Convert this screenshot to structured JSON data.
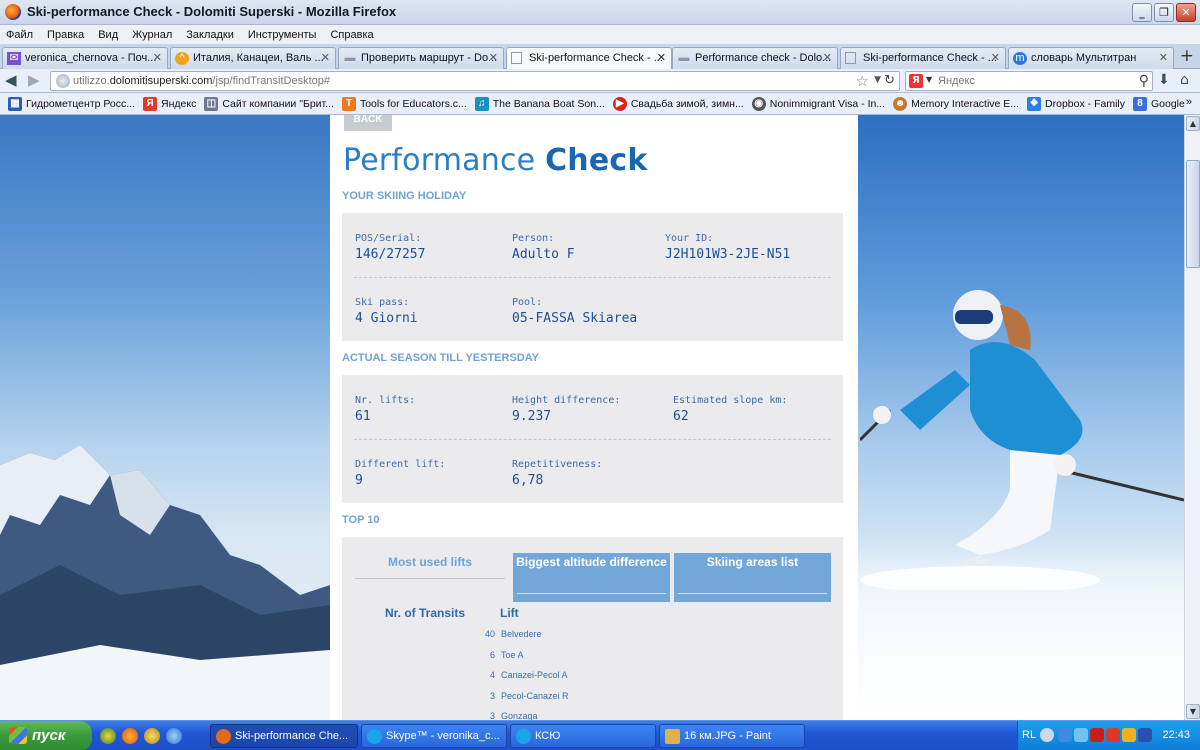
{
  "window": {
    "title": "Ski-performance Check - Dolomiti Superski - Mozilla Firefox",
    "controls": {
      "minimize": "_",
      "restore": "❐",
      "close": "✕"
    }
  },
  "menu": [
    "Файл",
    "Правка",
    "Вид",
    "Журнал",
    "Закладки",
    "Инструменты",
    "Справка"
  ],
  "tabs": [
    {
      "label": "veronica_chernova - Поч...",
      "icon": "mail-icon"
    },
    {
      "label": "Италия, Канацеи, Валь ...",
      "icon": "hotel-icon"
    },
    {
      "label": "Проверить маршрут - Do...",
      "icon": "page-icon"
    },
    {
      "label": "Ski-performance Check - ...",
      "icon": "page-icon",
      "active": true
    },
    {
      "label": "Performance check - Dolo...",
      "icon": "page-icon"
    },
    {
      "label": "Ski-performance Check - ...",
      "icon": "page-icon"
    },
    {
      "label": "словарь Мультитран",
      "icon": "dictionary-icon"
    }
  ],
  "nav": {
    "url_prefix": "utilizzo.",
    "url_domain": "dolomitisuperski.com",
    "url_path": "/jsp/findTransitDesktop#",
    "search_placeholder": "Яндекс",
    "search_engine_label": "Я"
  },
  "bookmarks": [
    {
      "label": "Гидрометцентр Росс...",
      "color": "#2a5bbd",
      "glyph": "▦"
    },
    {
      "label": "Яндекс",
      "color": "#e23a2a",
      "glyph": "Я"
    },
    {
      "label": "Сайт компании \"Брит...",
      "color": "#6b7890",
      "glyph": "◫"
    },
    {
      "label": "Tools for Educators.c...",
      "color": "#f07a1a",
      "glyph": "T"
    },
    {
      "label": "The Banana Boat Son...",
      "color": "#1b8fbf",
      "glyph": "♫"
    },
    {
      "label": "Свадьба зимой, зимн...",
      "color": "#d9261c",
      "glyph": "▶"
    },
    {
      "label": "Nonimmigrant Visa - In...",
      "color": "#555555",
      "glyph": "◉"
    },
    {
      "label": "Memory Interactive E...",
      "color": "#c47a2c",
      "glyph": "☻"
    },
    {
      "label": "Dropbox - Family",
      "color": "#2b7de9",
      "glyph": "❖"
    },
    {
      "label": "Google",
      "color": "#3b6fe0",
      "glyph": "8"
    }
  ],
  "page": {
    "back_label": "BACK",
    "title_light": "Performance",
    "title_bold": "Check",
    "section_holiday": "YOUR SKIING HOLIDAY",
    "holiday": {
      "pos_label": "POS/Serial:",
      "pos_value": "146/27257",
      "person_label": "Person:",
      "person_value": "Adulto F",
      "id_label": "Your ID:",
      "id_value": "J2H101W3-2JE-N51",
      "skipass_label": "Ski pass:",
      "skipass_value": "4 Giorni",
      "pool_label": "Pool:",
      "pool_value": "05-FASSA Skiarea"
    },
    "section_season": "ACTUAL SEASON TILL YESTERSDAY",
    "season": {
      "lifts_label": "Nr. lifts:",
      "lifts_value": "61",
      "height_label": "Height difference:",
      "height_value": "9.237",
      "slope_label": "Estimated slope km:",
      "slope_value": "62",
      "diff_label": "Different lift:",
      "diff_value": "9",
      "rep_label": "Repetitiveness:",
      "rep_value": "6,78"
    },
    "section_top": "TOP 10",
    "top_tabs": {
      "most_used": "Most used lifts",
      "biggest_alt": "Biggest altitude difference",
      "areas": "Skiing areas list"
    },
    "table": {
      "col_transits": "Nr. of Transits",
      "col_lift": "Lift",
      "rows": [
        {
          "n": "40",
          "lift": "Belvedere"
        },
        {
          "n": "6",
          "lift": "Toe A"
        },
        {
          "n": "4",
          "lift": "Canazei-Pecol A"
        },
        {
          "n": "3",
          "lift": "Pecol-Canazei R"
        },
        {
          "n": "3",
          "lift": "Gonzaga"
        }
      ]
    }
  },
  "scrollbar": {
    "up": "▲",
    "down": "▼"
  },
  "taskbar": {
    "start_label": "пуск",
    "items": [
      {
        "label": "Ski-performance Che...",
        "color": "#e36a1a",
        "active": true
      },
      {
        "label": "Skype™ - veronika_c...",
        "color": "#19a5e8"
      },
      {
        "label": "КСЮ",
        "color": "#19a5e8"
      },
      {
        "label": "16 км.JPG - Paint",
        "color": "#d9b44a"
      }
    ],
    "tray_lang": "RL",
    "clock": "22:43"
  }
}
